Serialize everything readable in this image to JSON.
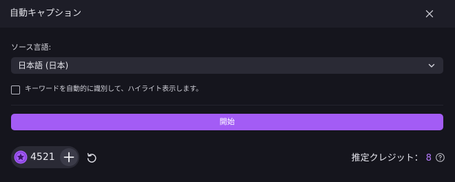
{
  "dialog": {
    "title": "自動キャプション",
    "close_icon": "close-icon"
  },
  "source_language": {
    "label": "ソース言語:",
    "selected": "日本語 (日本)",
    "dropdown_icon": "chevron-down-icon"
  },
  "keyword_option": {
    "checked": false,
    "label": "キーワードを自動的に識別して、ハイライト表示します。"
  },
  "start_button": {
    "label": "開始"
  },
  "credits": {
    "balance": "4521",
    "coin_icon": "purple-star-coin-icon",
    "add_icon": "plus-icon",
    "refresh_icon": "refresh-icon"
  },
  "estimate": {
    "label": "推定クレジット：",
    "value": "8",
    "help_icon": "help-icon"
  },
  "colors": {
    "accent": "#a35cf5",
    "accent_text": "#b57bff",
    "background": "#15151d",
    "titlebar": "#1d1d27",
    "field": "#2a2a35"
  }
}
